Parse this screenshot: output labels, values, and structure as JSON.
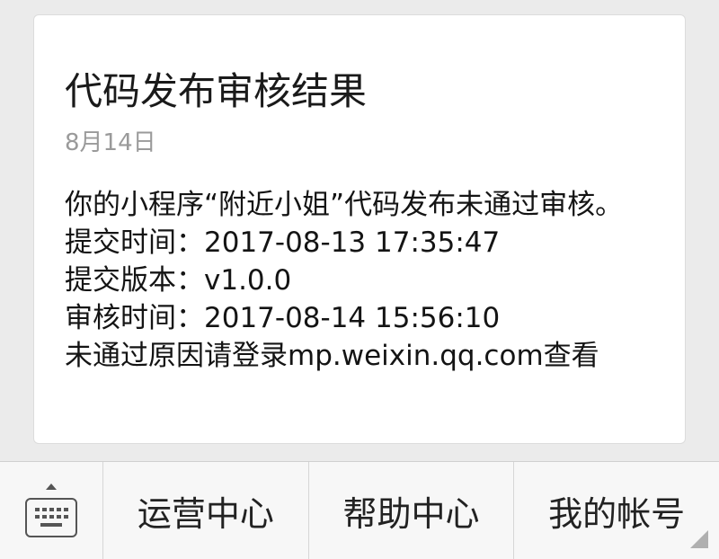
{
  "message": {
    "title": "代码发布审核结果",
    "date": "8月14日",
    "body_line_1": "你的小程序“附近小姐”代码发布未通过审核。",
    "submit_time": "提交时间：2017-08-13 17:35:47",
    "submit_version": "提交版本：v1.0.0",
    "review_time": "审核时间：2017-08-14 15:56:10",
    "reject_reason": "未通过原因请登录mp.weixin.qq.com查看"
  },
  "bottom_menu": {
    "keyboard_icon": "keyboard-icon",
    "items": [
      {
        "label": "运营中心"
      },
      {
        "label": "帮助中心"
      },
      {
        "label": "我的帐号"
      }
    ]
  }
}
